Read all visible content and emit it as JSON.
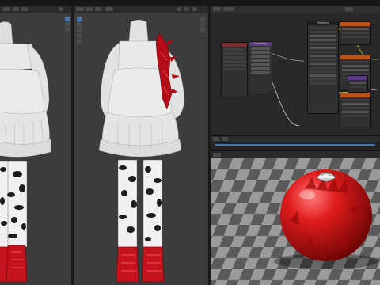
{
  "window": {
    "title": ""
  },
  "node_editor": {
    "nodes": [
      {
        "id": "mapping",
        "title": "Mapping"
      },
      {
        "id": "features",
        "title": "Features"
      }
    ]
  },
  "colors": {
    "accent": "#4772b3",
    "dress": "#e6e6e6",
    "boots": "#c4131c",
    "sphere": "#d91a1a",
    "node_header": "#b8541a"
  },
  "icons": [
    "move-tool-icon",
    "rotate-tool-icon",
    "scale-tool-icon",
    "cursor-tool-icon",
    "render-preview-icon"
  ]
}
